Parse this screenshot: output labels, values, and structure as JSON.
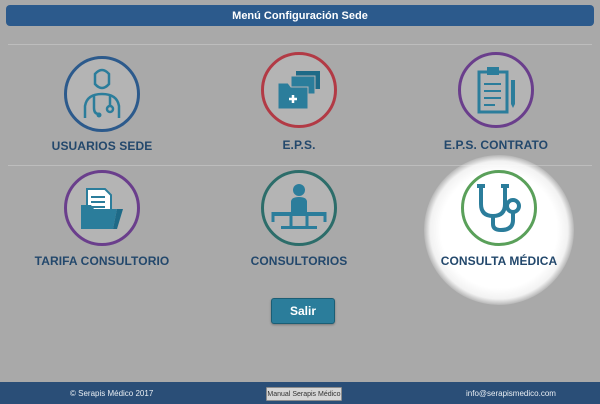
{
  "header": {
    "title": "Menú Configuración Sede"
  },
  "tiles": [
    {
      "label": "USUARIOS SEDE",
      "icon": "doctor-icon",
      "ring_color": "#2c5a8c"
    },
    {
      "label": "E.P.S.",
      "icon": "folder-plus-icon",
      "ring_color": "#b23a45"
    },
    {
      "label": "E.P.S. CONTRATO",
      "icon": "clipboard-pen-icon",
      "ring_color": "#6a3e8c"
    },
    {
      "label": "TARIFA CONSULTORIO",
      "icon": "folder-documents-icon",
      "ring_color": "#6a3e8c"
    },
    {
      "label": "CONSULTORIOS",
      "icon": "patient-on-bed-icon",
      "ring_color": "#2c6d6a"
    },
    {
      "label": "CONSULTA MÉDICA",
      "icon": "stethoscope-icon",
      "ring_color": "#5aa05a"
    }
  ],
  "buttons": {
    "exit_label": "Salir"
  },
  "footer": {
    "copyright": "© Serapis Médico 2017",
    "manual_label": "Manual Serapis Médico",
    "email": "info@serapismedico.com"
  },
  "colors": {
    "header_bg": "#2c5a8c",
    "footer_bg": "#2a4e77",
    "label_text": "#23486c",
    "exit_button": "#2b7d9b",
    "icon_fill": "#2b7d9b"
  }
}
